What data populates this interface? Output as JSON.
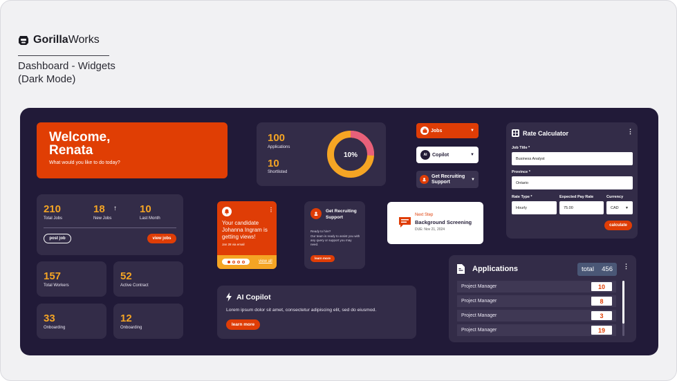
{
  "brand": {
    "name_bold": "Gorilla",
    "name_light": "Works"
  },
  "page": {
    "subtitle_line1": "Dashboard - Widgets",
    "subtitle_line2": "(Dark Mode)"
  },
  "colors": {
    "accent": "#e03e04",
    "gold": "#f5a524",
    "pink": "#e8607a",
    "bg_dark": "#211a38",
    "card": "#332c48"
  },
  "welcome": {
    "title_line1": "Welcome,",
    "title_line2": "Renata",
    "subtitle": "What would you like to do today?"
  },
  "applications_summary": {
    "applications_value": "100",
    "applications_label": "Applications",
    "shortlisted_value": "10",
    "shortlisted_label": "Shortlisted",
    "donut_label": "10%",
    "donut_fraction": 0.1
  },
  "quick_buttons": {
    "jobs": "Jobs",
    "ai_copilot": "Copilot",
    "recruiting": "Get Recruiting Support"
  },
  "rate_calculator": {
    "title": "Rate Calculator",
    "job_title_label": "Job Title *",
    "job_title_value": "Business Analyst",
    "province_label": "Province *",
    "province_value": "Ontario",
    "rate_type_label": "Rate Type *",
    "rate_type_value": "Hourly",
    "expected_pay_label": "Expected Pay Rate",
    "expected_pay_value": "75.00",
    "currency_label": "Currency",
    "currency_value": "CAD",
    "calculate_button": "calculate"
  },
  "jobs_stats": {
    "total_jobs_value": "210",
    "total_jobs_label": "Total Jobs",
    "new_jobs_value": "18",
    "new_jobs_label": "New Jobs",
    "last_month_value": "10",
    "last_month_label": "Last Month",
    "post_job_button": "post job",
    "view_jobs_button": "view jobs"
  },
  "notification": {
    "message": "Your candidate Johanna Ingram is getting views!",
    "date": "Jan 28 via email",
    "view_all": "view all"
  },
  "recruiting_support": {
    "title": "Get Recruiting Support",
    "body_line1": "Ready to hire?",
    "body_line2": "Our team is ready to assist you with any query or support you may need.",
    "button": "learn more"
  },
  "next_step": {
    "label": "Next Step",
    "title": "Background Screening",
    "due": "DUE: Nov 21, 2024"
  },
  "workers": [
    {
      "value": "157",
      "label": "Total Workers"
    },
    {
      "value": "52",
      "label": "Active Contract"
    },
    {
      "value": "33",
      "label": "Onboarding"
    },
    {
      "value": "12",
      "label": "Onboarding"
    }
  ],
  "ai_copilot": {
    "title": "AI Copilot",
    "body": "Lorem ipsum dolor sit amet, consectetur adipiscing elit, sed do eiusmod.",
    "button": "learn more"
  },
  "applications_list": {
    "title": "Applications",
    "total_label": "total",
    "total_value": "456",
    "rows": [
      {
        "name": "Project Manager",
        "count": "10"
      },
      {
        "name": "Project Manager",
        "count": "8"
      },
      {
        "name": "Project Manager",
        "count": "3"
      },
      {
        "name": "Project Manager",
        "count": "19"
      }
    ]
  }
}
